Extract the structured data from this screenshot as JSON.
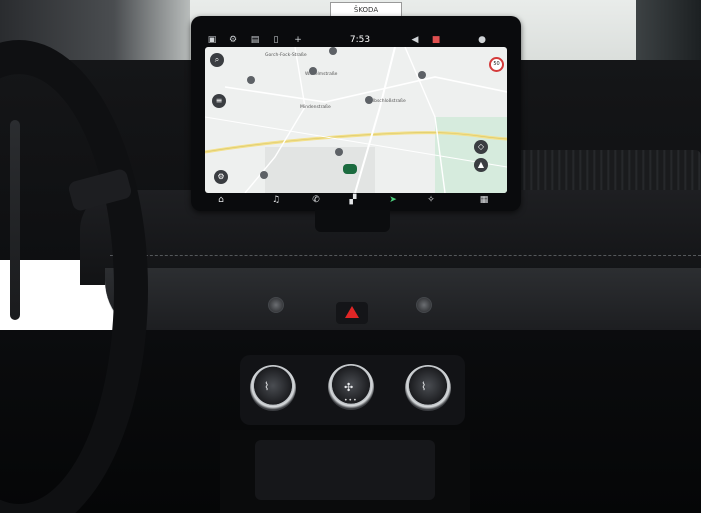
{
  "screen": {
    "clock": "7:53",
    "status_icons": [
      "car-icon",
      "settings-icon",
      "battery-icon",
      "phone-icon",
      "plus-icon",
      "volume-icon",
      "notification-icon",
      "profile-icon"
    ],
    "map": {
      "road_labels": [
        "Gorch-Fock-Straße",
        "Wilhelmstraße",
        "Mindenstraße",
        "Elbschloßstraße"
      ],
      "speed_limit": "50"
    },
    "dock_icons": [
      "home-icon",
      "music-icon",
      "phone-call-icon",
      "grid-icon",
      "navigation-icon",
      "climate-icon",
      "apps-icon"
    ]
  },
  "background": {
    "sign_text": "ŠKODA"
  },
  "colors": {
    "map_background": "#eef0ef",
    "hazard": "#e02626",
    "nav_arrow": "#1b6b3f"
  }
}
